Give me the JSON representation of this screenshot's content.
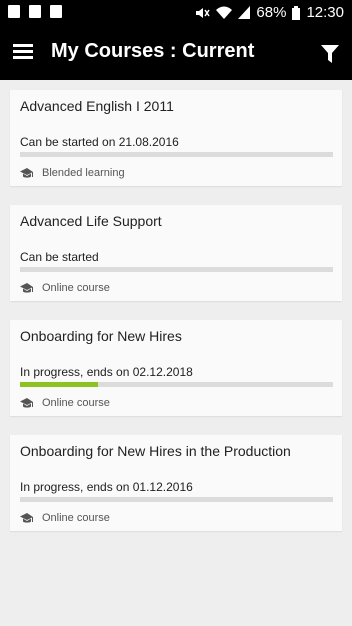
{
  "status_bar": {
    "battery": "68%",
    "time": "12:30"
  },
  "app_bar": {
    "title": "My Courses : Current"
  },
  "courses": [
    {
      "title": "Advanced English I 2011",
      "status": "Can be started on 21.08.2016",
      "progress": 0,
      "type": "Blended learning"
    },
    {
      "title": "Advanced Life Support",
      "status": "Can be started",
      "progress": 0,
      "type": "Online course"
    },
    {
      "title": "Onboarding for New Hires",
      "status": "In progress, ends on 02.12.2018",
      "progress": 0.25,
      "type": "Online course"
    },
    {
      "title": "Onboarding for New Hires in the Production",
      "status": "In progress, ends on 01.12.2016",
      "progress": 0,
      "type": "Online course"
    }
  ],
  "colors": {
    "progress": "#8cc320",
    "track": "#dcdcdc",
    "appbar": "#000000"
  }
}
